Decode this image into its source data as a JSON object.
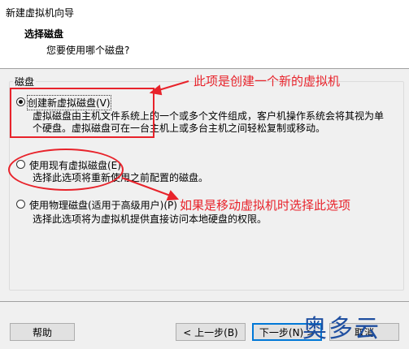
{
  "window": {
    "title": "新建虚拟机向导"
  },
  "header": {
    "title": "选择磁盘",
    "subtitle": "您要使用哪个磁盘?"
  },
  "group": {
    "label": "磁盘"
  },
  "options": [
    {
      "label": "创建新虚拟磁盘(V)",
      "desc_line1": "虚拟磁盘由主机文件系统上的一个或多个文件组成，客户机操作系统会将其视为单",
      "desc_line2": "个硬盘。虚拟磁盘可在一台主机上或多台主机之间轻松复制或移动。",
      "selected": true
    },
    {
      "label": "使用现有虚拟磁盘(E)",
      "desc_line1": "选择此选项将重新使用之前配置的磁盘。",
      "selected": false
    },
    {
      "label": "使用物理磁盘(适用于高级用户)(P)",
      "desc_line1": "选择此选项将为虚拟机提供直接访问本地硬盘的权限。",
      "selected": false
    }
  ],
  "annotations": {
    "note1": "此项是创建一个新的虚拟机",
    "note2": "如果是移动虚拟机时选择此选项",
    "color": "#e8232b"
  },
  "buttons": {
    "help": "帮助",
    "back": "< 上一步(B)",
    "next": "下一步(N) >",
    "cancel": "取消"
  },
  "watermark": "奥多云"
}
